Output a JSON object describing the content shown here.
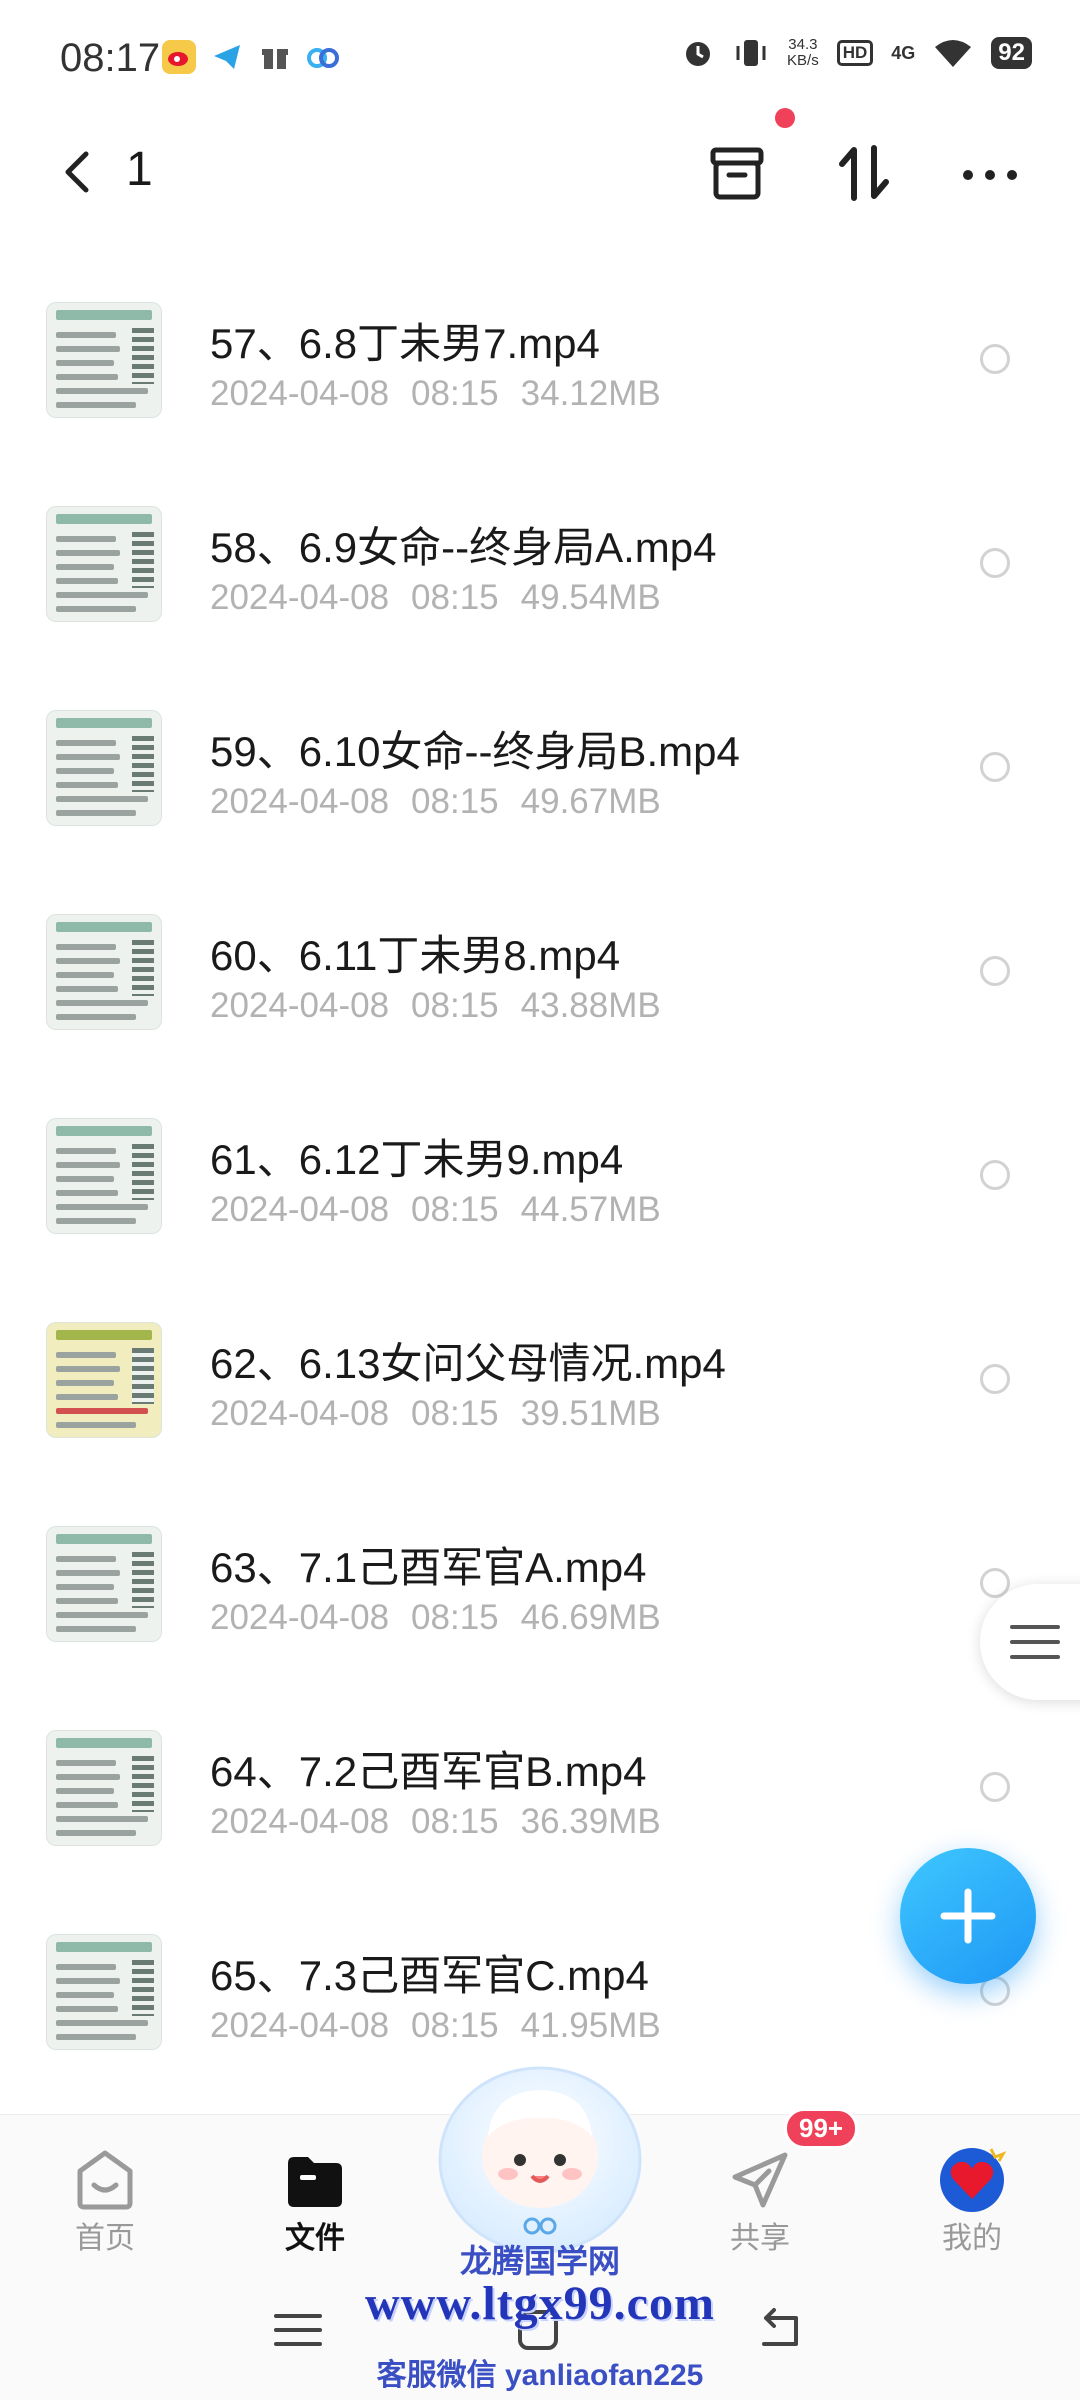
{
  "status_bar": {
    "time": "08:17",
    "net_speed_value": "34.3",
    "net_speed_unit": "KB/s",
    "hd": "HD",
    "network": "4G",
    "battery": "92"
  },
  "top_bar": {
    "title": "1"
  },
  "files": [
    {
      "name": "57、6.8丁未男7.mp4",
      "date": "2024-04-08",
      "time": "08:15",
      "size": "34.12MB"
    },
    {
      "name": "58、6.9女命--终身局A.mp4",
      "date": "2024-04-08",
      "time": "08:15",
      "size": "49.54MB"
    },
    {
      "name": "59、6.10女命--终身局B.mp4",
      "date": "2024-04-08",
      "time": "08:15",
      "size": "49.67MB"
    },
    {
      "name": "60、6.11丁未男8.mp4",
      "date": "2024-04-08",
      "time": "08:15",
      "size": "43.88MB"
    },
    {
      "name": "61、6.12丁未男9.mp4",
      "date": "2024-04-08",
      "time": "08:15",
      "size": "44.57MB"
    },
    {
      "name": "62、6.13女问父母情况.mp4",
      "date": "2024-04-08",
      "time": "08:15",
      "size": "39.51MB"
    },
    {
      "name": "63、7.1己酉军官A.mp4",
      "date": "2024-04-08",
      "time": "08:15",
      "size": "46.69MB"
    },
    {
      "name": "64、7.2己酉军官B.mp4",
      "date": "2024-04-08",
      "time": "08:15",
      "size": "36.39MB"
    },
    {
      "name": "65、7.3己酉军官C.mp4",
      "date": "2024-04-08",
      "time": "08:15",
      "size": "41.95MB"
    }
  ],
  "bottom_nav": {
    "home": "首页",
    "files": "文件",
    "share": "共享",
    "mine": "我的",
    "share_badge": "99+"
  },
  "watermark": {
    "line1": "龙腾国学网",
    "line2": "www.ltgx99.com",
    "line3": "客服微信 yanliaofan225"
  },
  "colors": {
    "accent": "#1e97f5",
    "badge_red": "#f0415a",
    "meta_gray": "#b2b2b2"
  }
}
